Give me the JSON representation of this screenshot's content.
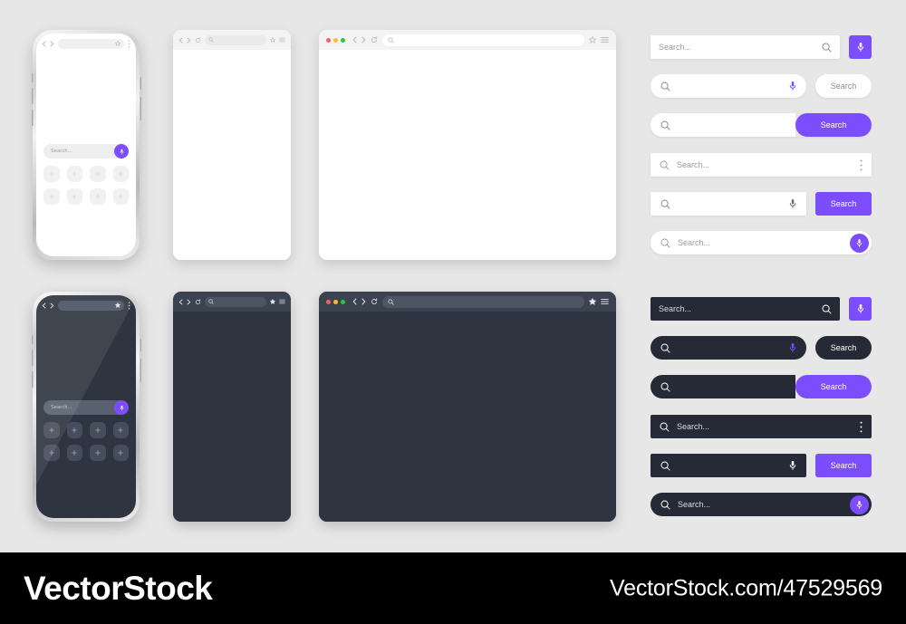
{
  "background_color": "#e7e7e7",
  "accent_color": "#7c4dfd",
  "dark_surface_color": "#2e3440",
  "dark_field_color": "#252a36",
  "placeholder": "Search...",
  "search_label": "Search",
  "mockups": {
    "phone_light": {
      "name": "Light phone browser mockup",
      "topbar": {
        "back_icon": "chevron-left-icon",
        "forward_icon": "chevron-right-icon",
        "url_value": "",
        "star_icon": "star-icon",
        "menu_icon": "dots-vertical-icon"
      },
      "search": {
        "placeholder": "Search...",
        "mic_icon": "microphone-icon"
      },
      "tiles": [
        "+",
        "+",
        "+",
        "+",
        "+",
        "+",
        "+",
        "+"
      ]
    },
    "phone_dark": {
      "name": "Dark phone browser mockup",
      "topbar": {
        "back_icon": "chevron-left-icon",
        "forward_icon": "chevron-right-icon",
        "url_value": "",
        "star_icon": "star-icon",
        "menu_icon": "dots-vertical-icon"
      },
      "search": {
        "placeholder": "Search...",
        "mic_icon": "microphone-icon"
      },
      "tiles": [
        "+",
        "+",
        "+",
        "+",
        "+",
        "+",
        "+",
        "+"
      ]
    },
    "tablet_light": {
      "name": "Light tablet browser mockup",
      "topbar": {
        "back_icon": "chevron-left-icon",
        "forward_icon": "chevron-right-icon",
        "reload_icon": "reload-icon",
        "search_icon": "search-icon",
        "url_value": "",
        "star_icon": "star-icon",
        "menu_icon": "hamburger-icon"
      }
    },
    "tablet_dark": {
      "name": "Dark tablet browser mockup",
      "topbar": {
        "back_icon": "chevron-left-icon",
        "forward_icon": "chevron-right-icon",
        "reload_icon": "reload-icon",
        "search_icon": "search-icon",
        "url_value": "",
        "star_icon": "star-icon",
        "menu_icon": "hamburger-icon"
      }
    },
    "browser_light": {
      "name": "Light desktop browser window mockup",
      "traffic_lights": [
        "#ff5f57",
        "#febc2e",
        "#28c840"
      ],
      "topbar": {
        "back_icon": "chevron-left-icon",
        "forward_icon": "chevron-right-icon",
        "reload_icon": "reload-icon",
        "search_icon": "search-icon",
        "url_value": "",
        "star_icon": "star-icon",
        "menu_icon": "hamburger-icon"
      }
    },
    "browser_dark": {
      "name": "Dark desktop browser window mockup",
      "traffic_lights": [
        "#ff5f57",
        "#febc2e",
        "#28c840"
      ],
      "topbar": {
        "back_icon": "chevron-left-icon",
        "forward_icon": "chevron-right-icon",
        "reload_icon": "reload-icon",
        "search_icon": "search-icon",
        "url_value": "",
        "star_icon": "star-icon",
        "menu_icon": "hamburger-icon"
      }
    }
  },
  "search_bars_light": [
    {
      "id": "light-1",
      "variant": "field-with-square-mic-button",
      "placeholder": "Search...",
      "value": "",
      "trailing_icon": "search-icon",
      "mic_icon": "microphone-icon"
    },
    {
      "id": "light-2",
      "variant": "rounded-field-with-mic-and-separate-button",
      "placeholder": "",
      "value": "",
      "leading_icon": "search-icon",
      "mic_icon": "microphone-icon",
      "button_label": "Search"
    },
    {
      "id": "light-3",
      "variant": "rounded-field-with-attached-purple-button",
      "placeholder": "",
      "value": "",
      "leading_icon": "search-icon",
      "button_label": "Search"
    },
    {
      "id": "light-4",
      "variant": "flat-field-with-overflow-menu",
      "placeholder": "Search...",
      "value": "",
      "leading_icon": "search-icon",
      "menu_icon": "dots-vertical-icon"
    },
    {
      "id": "light-5",
      "variant": "square-field-with-mic-and-purple-button",
      "placeholder": "",
      "value": "",
      "leading_icon": "search-icon",
      "mic_icon": "microphone-icon",
      "button_label": "Search"
    },
    {
      "id": "light-6",
      "variant": "pill-field-with-circular-mic",
      "placeholder": "Search...",
      "value": "",
      "leading_icon": "search-icon",
      "mic_icon": "microphone-icon"
    }
  ],
  "search_bars_dark": [
    {
      "id": "dark-1",
      "variant": "field-with-square-mic-button",
      "placeholder": "Search...",
      "value": "",
      "trailing_icon": "search-icon",
      "mic_icon": "microphone-icon"
    },
    {
      "id": "dark-2",
      "variant": "rounded-field-with-mic-and-separate-button",
      "placeholder": "",
      "value": "",
      "leading_icon": "search-icon",
      "mic_icon": "microphone-icon",
      "button_label": "Search"
    },
    {
      "id": "dark-3",
      "variant": "rounded-field-with-attached-purple-button",
      "placeholder": "",
      "value": "",
      "leading_icon": "search-icon",
      "button_label": "Search"
    },
    {
      "id": "dark-4",
      "variant": "flat-field-with-overflow-menu",
      "placeholder": "Search...",
      "value": "",
      "leading_icon": "search-icon",
      "menu_icon": "dots-vertical-icon"
    },
    {
      "id": "dark-5",
      "variant": "square-field-with-mic-and-purple-button",
      "placeholder": "",
      "value": "",
      "leading_icon": "search-icon",
      "mic_icon": "microphone-icon",
      "button_label": "Search"
    },
    {
      "id": "dark-6",
      "variant": "pill-field-with-circular-mic",
      "placeholder": "Search...",
      "value": "",
      "leading_icon": "search-icon",
      "mic_icon": "microphone-icon"
    }
  ],
  "footer": {
    "logo": "VectorStock",
    "url": "VectorStock.com/47529569"
  }
}
